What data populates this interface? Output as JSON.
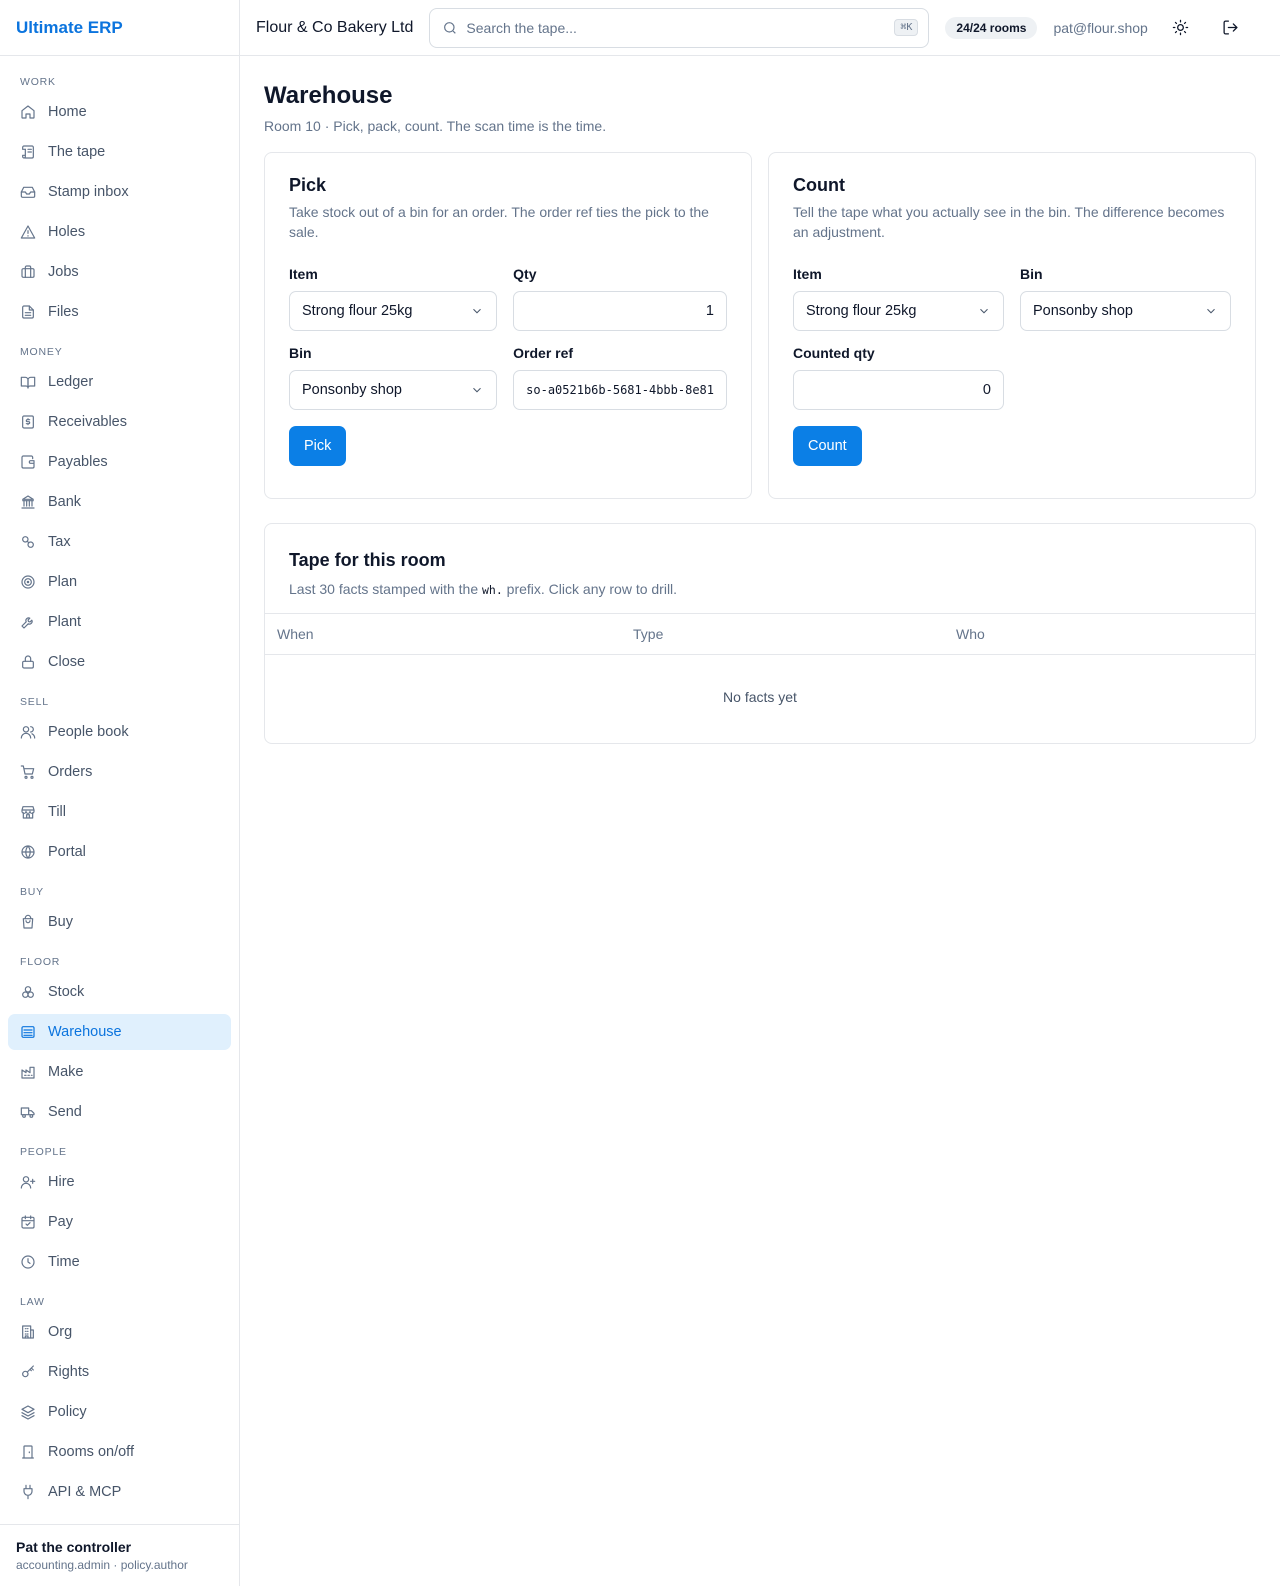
{
  "brand": "Ultimate ERP",
  "sidebar": {
    "sections": [
      {
        "label": "WORK",
        "items": [
          {
            "label": "Home",
            "icon": "home-icon"
          },
          {
            "label": "The tape",
            "icon": "scroll-icon"
          },
          {
            "label": "Stamp inbox",
            "icon": "inbox-icon"
          },
          {
            "label": "Holes",
            "icon": "alert-triangle-icon"
          },
          {
            "label": "Jobs",
            "icon": "briefcase-icon"
          },
          {
            "label": "Files",
            "icon": "file-icon"
          }
        ]
      },
      {
        "label": "MONEY",
        "items": [
          {
            "label": "Ledger",
            "icon": "book-icon"
          },
          {
            "label": "Receivables",
            "icon": "dollar-receipt-icon"
          },
          {
            "label": "Payables",
            "icon": "wallet-icon"
          },
          {
            "label": "Bank",
            "icon": "bank-icon"
          },
          {
            "label": "Tax",
            "icon": "percent-icon"
          },
          {
            "label": "Plan",
            "icon": "target-icon"
          },
          {
            "label": "Plant",
            "icon": "wrench-icon"
          },
          {
            "label": "Close",
            "icon": "lock-icon"
          }
        ]
      },
      {
        "label": "SELL",
        "items": [
          {
            "label": "People book",
            "icon": "users-icon"
          },
          {
            "label": "Orders",
            "icon": "cart-icon"
          },
          {
            "label": "Till",
            "icon": "store-icon"
          },
          {
            "label": "Portal",
            "icon": "globe-icon"
          }
        ]
      },
      {
        "label": "BUY",
        "items": [
          {
            "label": "Buy",
            "icon": "shopping-bag-icon"
          }
        ]
      },
      {
        "label": "FLOOR",
        "items": [
          {
            "label": "Stock",
            "icon": "boxes-icon"
          },
          {
            "label": "Warehouse",
            "icon": "warehouse-icon",
            "active": true
          },
          {
            "label": "Make",
            "icon": "factory-icon"
          },
          {
            "label": "Send",
            "icon": "truck-icon"
          }
        ]
      },
      {
        "label": "PEOPLE",
        "items": [
          {
            "label": "Hire",
            "icon": "user-plus-icon"
          },
          {
            "label": "Pay",
            "icon": "calendar-check-icon"
          },
          {
            "label": "Time",
            "icon": "clock-icon"
          }
        ]
      },
      {
        "label": "LAW",
        "items": [
          {
            "label": "Org",
            "icon": "building-icon"
          },
          {
            "label": "Rights",
            "icon": "key-icon"
          },
          {
            "label": "Policy",
            "icon": "layers-icon"
          },
          {
            "label": "Rooms on/off",
            "icon": "door-icon"
          },
          {
            "label": "API & MCP",
            "icon": "plug-icon"
          }
        ]
      }
    ]
  },
  "user": {
    "name": "Pat the controller",
    "roles": "accounting.admin · policy.author"
  },
  "topbar": {
    "company": "Flour & Co Bakery Ltd",
    "search_placeholder": "Search the tape...",
    "search_shortcut": "⌘K",
    "rooms_badge": "24/24 rooms",
    "email": "pat@flour.shop",
    "theme_icon": "sun-icon",
    "logout_icon": "logout-icon"
  },
  "page": {
    "title": "Warehouse",
    "subtitle": "Room 10 · Pick, pack, count. The scan time is the time."
  },
  "pick": {
    "title": "Pick",
    "desc": "Take stock out of a bin for an order. The order ref ties the pick to the sale.",
    "item_label": "Item",
    "item_value": "Strong flour 25kg",
    "qty_label": "Qty",
    "qty_value": "1",
    "bin_label": "Bin",
    "bin_value": "Ponsonby shop",
    "order_label": "Order ref",
    "order_value": "so-a0521b6b-5681-4bbb-8e81",
    "button": "Pick"
  },
  "count": {
    "title": "Count",
    "desc": "Tell the tape what you actually see in the bin. The difference becomes an adjustment.",
    "item_label": "Item",
    "item_value": "Strong flour 25kg",
    "bin_label": "Bin",
    "bin_value": "Ponsonby shop",
    "counted_label": "Counted qty",
    "counted_value": "0",
    "button": "Count"
  },
  "tape": {
    "title": "Tape for this room",
    "desc_pre": "Last 30 facts stamped with the ",
    "desc_code": "wh.",
    "desc_post": " prefix. Click any row to drill.",
    "columns": [
      "When",
      "Type",
      "Who"
    ],
    "empty": "No facts yet"
  },
  "colors": {
    "accent": "#0b7fe6",
    "active_bg": "#e0f0fd",
    "muted": "#64748b"
  }
}
